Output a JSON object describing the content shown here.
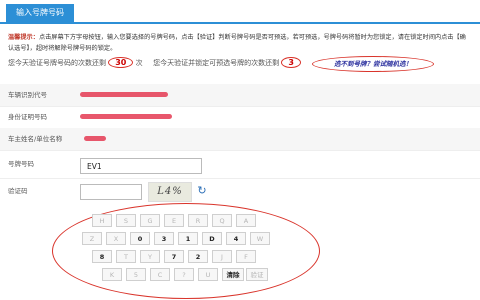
{
  "tab": {
    "label": "输入号牌号码"
  },
  "notice": {
    "lead": "温馨提示：",
    "text": "点击屏幕下方字母按钮，输入您要选择的号牌号码，点击【验证】判断号牌号码是否可预选，若可预选，号牌号码将暂时为您锁定，请在锁定时间内点击【确认选号】，超时将解除号牌号码的锁定。"
  },
  "counts": {
    "verify_prefix": "您今天验证号牌号码的次数还剩",
    "verify_count": "30",
    "verify_suffix": "次",
    "lock_prefix": "您今天验证并锁定可预选号牌的次数还剩",
    "lock_count": "3",
    "banner": "选不到号牌？尝试随机选！"
  },
  "form": {
    "vin_label": "车辆识别代号",
    "id_label": "身份证明号码",
    "owner_label": "车主姓名/单位名称",
    "plate_label": "号牌号码",
    "plate_value": "EV1",
    "captcha_label": "验证码",
    "captcha_text": "L4%"
  },
  "keypad": {
    "rows": [
      [
        "H",
        "S",
        "G",
        "E",
        "R",
        "Q",
        "A"
      ],
      [
        "Z",
        "X",
        "0",
        "3",
        "1",
        "D",
        "4",
        "W"
      ],
      [
        "8",
        "T",
        "Y",
        "7",
        "2",
        "J",
        "F"
      ],
      [
        "K",
        "5",
        "C",
        "?",
        "U",
        "清除",
        "验证"
      ]
    ],
    "enabled": [
      "0",
      "3",
      "1",
      "D",
      "4",
      "8",
      "7",
      "2",
      "清除"
    ]
  },
  "colors": {
    "accent": "#2c8fd6",
    "warn": "#d9342b",
    "banner_text": "#2a2f9e"
  }
}
